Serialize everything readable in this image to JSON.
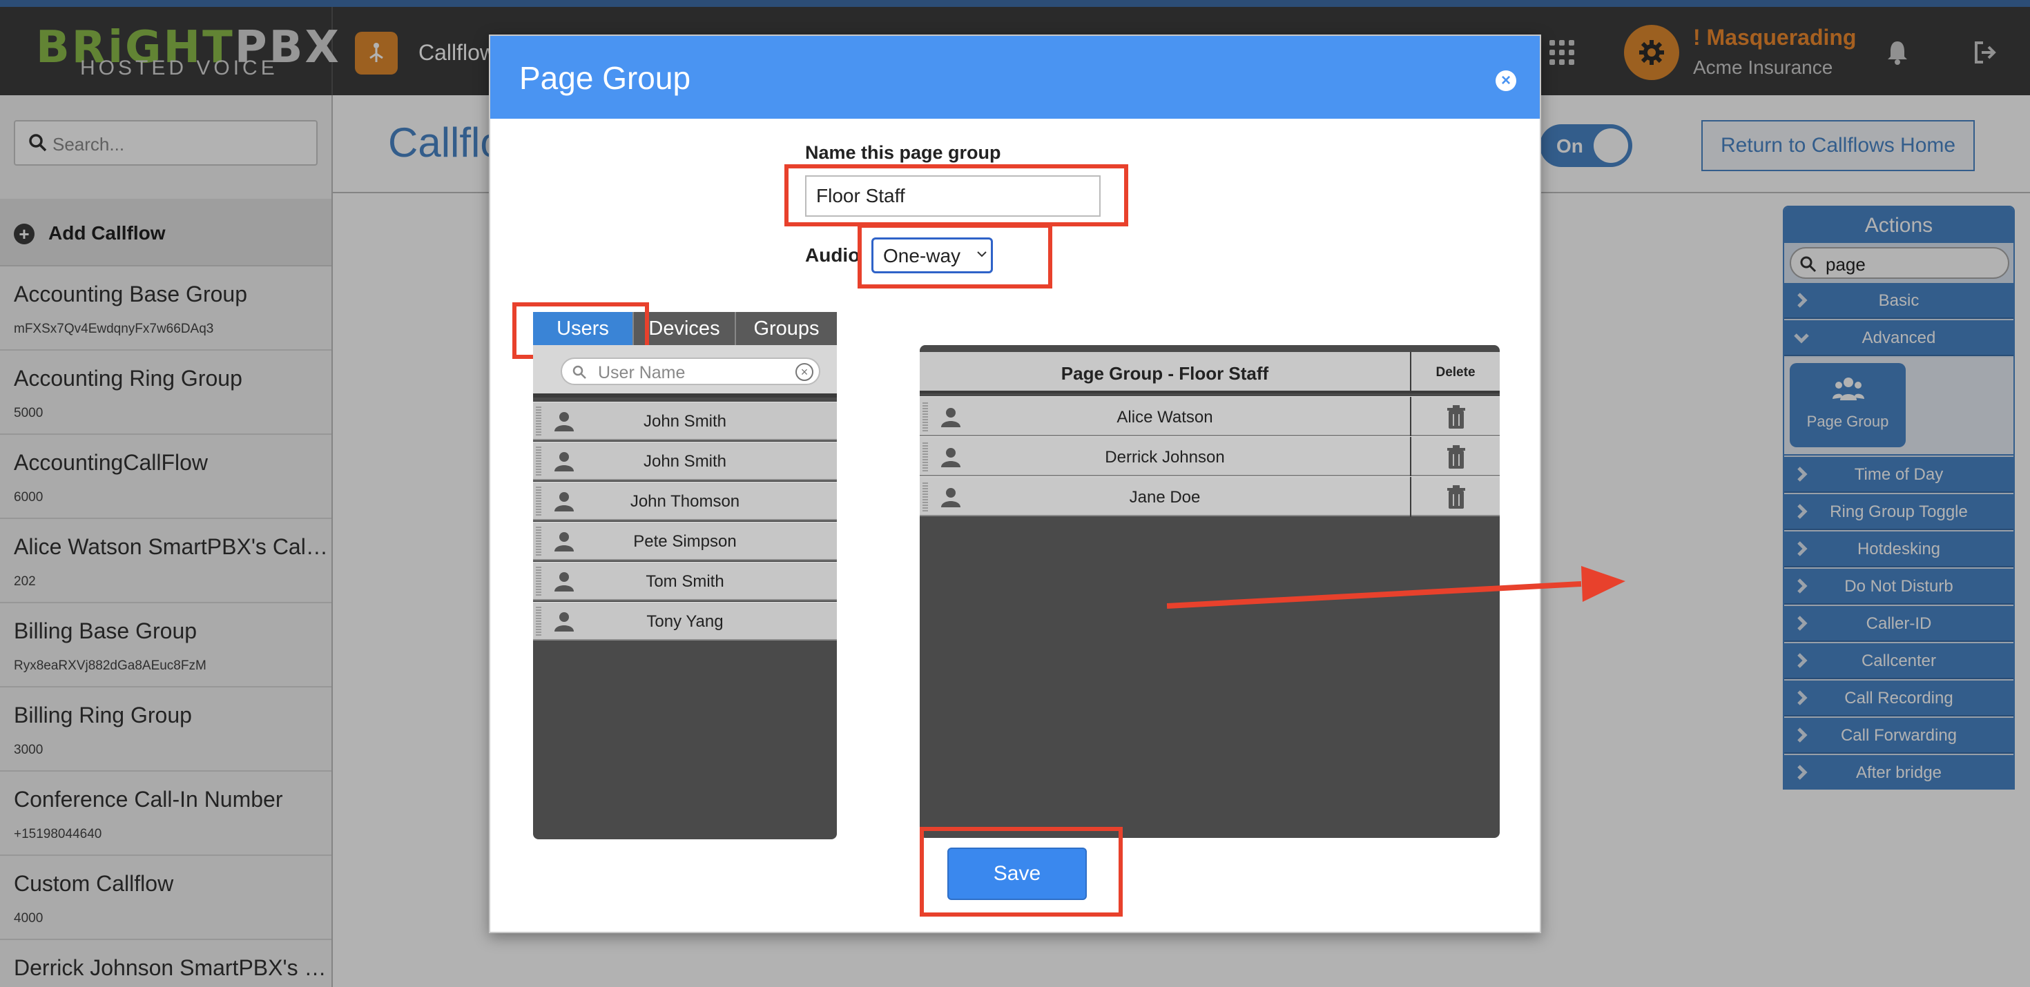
{
  "brand": {
    "name_part1": "BRiGHT",
    "name_part2": "PBX",
    "subtitle": "HOSTED VOICE"
  },
  "topbar": {
    "app_title": "Callflow",
    "masquerade_title": "! Masquerading",
    "masquerade_account": "Acme Insurance"
  },
  "sidebar": {
    "search_placeholder": "Search...",
    "add_label": "Add Callflow",
    "items": [
      {
        "name": "Accounting Base Group",
        "number": "mFXSx7Qv4EwdqnyFx7w66DAq3"
      },
      {
        "name": "Accounting Ring Group",
        "number": "5000"
      },
      {
        "name": "AccountingCallFlow",
        "number": "6000"
      },
      {
        "name": "Alice Watson SmartPBX's Callflow",
        "number": "202"
      },
      {
        "name": "Billing Base Group",
        "number": "Ryx8eaRXVj882dGa8AEuc8FzM"
      },
      {
        "name": "Billing Ring Group",
        "number": "3000"
      },
      {
        "name": "Conference Call-In Number",
        "number": "+15198044640"
      },
      {
        "name": "Custom Callflow",
        "number": "4000"
      },
      {
        "name": "Derrick Johnson SmartPBX's Cal…",
        "number": ""
      }
    ]
  },
  "main": {
    "title": "Callflo",
    "toggle_label": "On",
    "return_button": "Return to Callflows Home"
  },
  "actions_panel": {
    "header": "Actions",
    "search_value": "page",
    "items_top": [
      "Basic",
      "Advanced"
    ],
    "tile_label": "Page Group",
    "items_bottom": [
      "Time of Day",
      "Ring Group Toggle",
      "Hotdesking",
      "Do Not Disturb",
      "Caller-ID",
      "Callcenter",
      "Call Recording",
      "Call Forwarding",
      "After bridge"
    ]
  },
  "modal": {
    "title": "Page Group",
    "close_glyph": "×",
    "name_label": "Name this page group",
    "name_value": "Floor Staff",
    "audio_label": "Audio",
    "audio_value": "One-way",
    "tabs": [
      "Users",
      "Devices",
      "Groups"
    ],
    "user_search_placeholder": "User Name",
    "clear_glyph": "×",
    "users": [
      "John Smith",
      "John Smith",
      "John Thomson",
      "Pete Simpson",
      "Tom Smith",
      "Tony Yang"
    ],
    "group_header": "Page Group - Floor Staff",
    "delete_header": "Delete",
    "members": [
      "Alice Watson",
      "Derrick Johnson",
      "Jane Doe"
    ],
    "save_label": "Save"
  },
  "colors": {
    "accent_blue": "#4a94f2",
    "highlight_red": "#e8412c",
    "orange": "#e08a2e",
    "nav_dark": "#3d3d3d"
  },
  "icons": [
    "search-icon",
    "plus-icon",
    "grid-icon",
    "gear-icon",
    "bell-icon",
    "logout-icon",
    "chevron-right-icon",
    "chevron-down-icon",
    "users-icon",
    "person-icon",
    "trash-icon",
    "close-icon"
  ]
}
